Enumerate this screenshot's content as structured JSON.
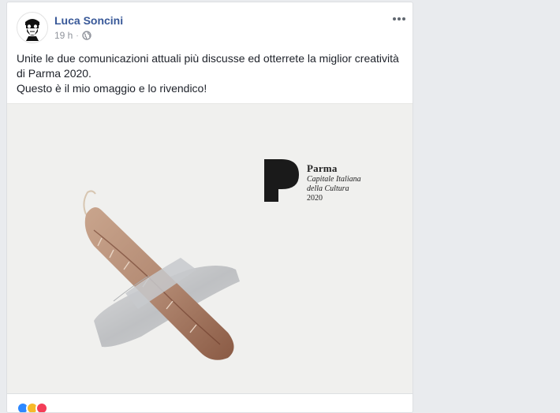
{
  "post": {
    "author": "Luca Soncini",
    "time": "19 h",
    "text": [
      "Unite le due comunicazioni attuali più discusse ed otterrete la miglior creatività di Parma 2020.",
      "Questo è il mio omaggio e lo rivendico!"
    ]
  },
  "image": {
    "logo_title": "Parma",
    "logo_line1": "Capitale Italiana",
    "logo_line2": "della Cultura",
    "logo_year": "2020"
  },
  "colors": {
    "author": "#385898",
    "background": "#e9ebee",
    "reaction_like": "#2d88ff",
    "reaction_haha": "#f7b928",
    "reaction_love": "#f33e58"
  },
  "icons": [
    "globe-icon",
    "more-options-icon",
    "avatar-illustration"
  ]
}
